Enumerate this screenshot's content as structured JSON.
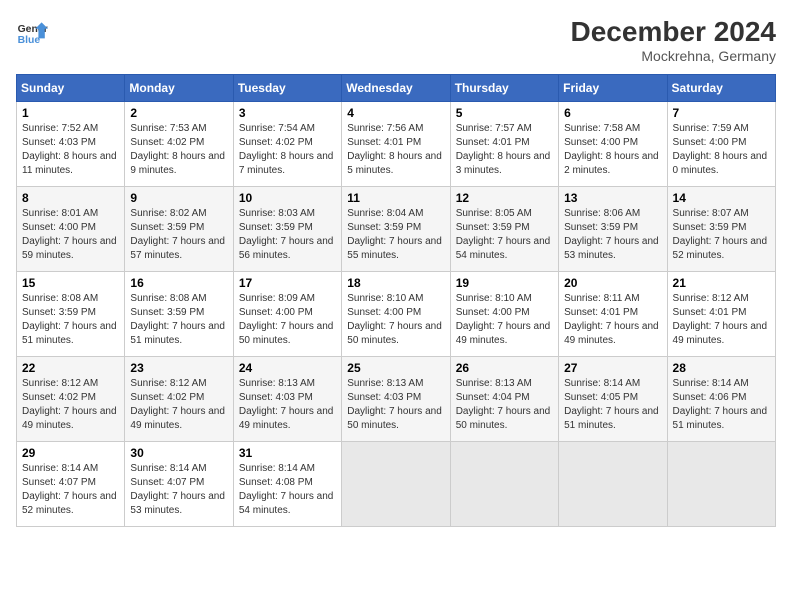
{
  "header": {
    "logo_line1": "General",
    "logo_line2": "Blue",
    "month_year": "December 2024",
    "location": "Mockrehna, Germany"
  },
  "weekdays": [
    "Sunday",
    "Monday",
    "Tuesday",
    "Wednesday",
    "Thursday",
    "Friday",
    "Saturday"
  ],
  "weeks": [
    [
      {
        "day": "1",
        "sunrise": "7:52 AM",
        "sunset": "4:03 PM",
        "daylight": "8 hours and 11 minutes."
      },
      {
        "day": "2",
        "sunrise": "7:53 AM",
        "sunset": "4:02 PM",
        "daylight": "8 hours and 9 minutes."
      },
      {
        "day": "3",
        "sunrise": "7:54 AM",
        "sunset": "4:02 PM",
        "daylight": "8 hours and 7 minutes."
      },
      {
        "day": "4",
        "sunrise": "7:56 AM",
        "sunset": "4:01 PM",
        "daylight": "8 hours and 5 minutes."
      },
      {
        "day": "5",
        "sunrise": "7:57 AM",
        "sunset": "4:01 PM",
        "daylight": "8 hours and 3 minutes."
      },
      {
        "day": "6",
        "sunrise": "7:58 AM",
        "sunset": "4:00 PM",
        "daylight": "8 hours and 2 minutes."
      },
      {
        "day": "7",
        "sunrise": "7:59 AM",
        "sunset": "4:00 PM",
        "daylight": "8 hours and 0 minutes."
      }
    ],
    [
      {
        "day": "8",
        "sunrise": "8:01 AM",
        "sunset": "4:00 PM",
        "daylight": "7 hours and 59 minutes."
      },
      {
        "day": "9",
        "sunrise": "8:02 AM",
        "sunset": "3:59 PM",
        "daylight": "7 hours and 57 minutes."
      },
      {
        "day": "10",
        "sunrise": "8:03 AM",
        "sunset": "3:59 PM",
        "daylight": "7 hours and 56 minutes."
      },
      {
        "day": "11",
        "sunrise": "8:04 AM",
        "sunset": "3:59 PM",
        "daylight": "7 hours and 55 minutes."
      },
      {
        "day": "12",
        "sunrise": "8:05 AM",
        "sunset": "3:59 PM",
        "daylight": "7 hours and 54 minutes."
      },
      {
        "day": "13",
        "sunrise": "8:06 AM",
        "sunset": "3:59 PM",
        "daylight": "7 hours and 53 minutes."
      },
      {
        "day": "14",
        "sunrise": "8:07 AM",
        "sunset": "3:59 PM",
        "daylight": "7 hours and 52 minutes."
      }
    ],
    [
      {
        "day": "15",
        "sunrise": "8:08 AM",
        "sunset": "3:59 PM",
        "daylight": "7 hours and 51 minutes."
      },
      {
        "day": "16",
        "sunrise": "8:08 AM",
        "sunset": "3:59 PM",
        "daylight": "7 hours and 51 minutes."
      },
      {
        "day": "17",
        "sunrise": "8:09 AM",
        "sunset": "4:00 PM",
        "daylight": "7 hours and 50 minutes."
      },
      {
        "day": "18",
        "sunrise": "8:10 AM",
        "sunset": "4:00 PM",
        "daylight": "7 hours and 50 minutes."
      },
      {
        "day": "19",
        "sunrise": "8:10 AM",
        "sunset": "4:00 PM",
        "daylight": "7 hours and 49 minutes."
      },
      {
        "day": "20",
        "sunrise": "8:11 AM",
        "sunset": "4:01 PM",
        "daylight": "7 hours and 49 minutes."
      },
      {
        "day": "21",
        "sunrise": "8:12 AM",
        "sunset": "4:01 PM",
        "daylight": "7 hours and 49 minutes."
      }
    ],
    [
      {
        "day": "22",
        "sunrise": "8:12 AM",
        "sunset": "4:02 PM",
        "daylight": "7 hours and 49 minutes."
      },
      {
        "day": "23",
        "sunrise": "8:12 AM",
        "sunset": "4:02 PM",
        "daylight": "7 hours and 49 minutes."
      },
      {
        "day": "24",
        "sunrise": "8:13 AM",
        "sunset": "4:03 PM",
        "daylight": "7 hours and 49 minutes."
      },
      {
        "day": "25",
        "sunrise": "8:13 AM",
        "sunset": "4:03 PM",
        "daylight": "7 hours and 50 minutes."
      },
      {
        "day": "26",
        "sunrise": "8:13 AM",
        "sunset": "4:04 PM",
        "daylight": "7 hours and 50 minutes."
      },
      {
        "day": "27",
        "sunrise": "8:14 AM",
        "sunset": "4:05 PM",
        "daylight": "7 hours and 51 minutes."
      },
      {
        "day": "28",
        "sunrise": "8:14 AM",
        "sunset": "4:06 PM",
        "daylight": "7 hours and 51 minutes."
      }
    ],
    [
      {
        "day": "29",
        "sunrise": "8:14 AM",
        "sunset": "4:07 PM",
        "daylight": "7 hours and 52 minutes."
      },
      {
        "day": "30",
        "sunrise": "8:14 AM",
        "sunset": "4:07 PM",
        "daylight": "7 hours and 53 minutes."
      },
      {
        "day": "31",
        "sunrise": "8:14 AM",
        "sunset": "4:08 PM",
        "daylight": "7 hours and 54 minutes."
      },
      null,
      null,
      null,
      null
    ]
  ]
}
